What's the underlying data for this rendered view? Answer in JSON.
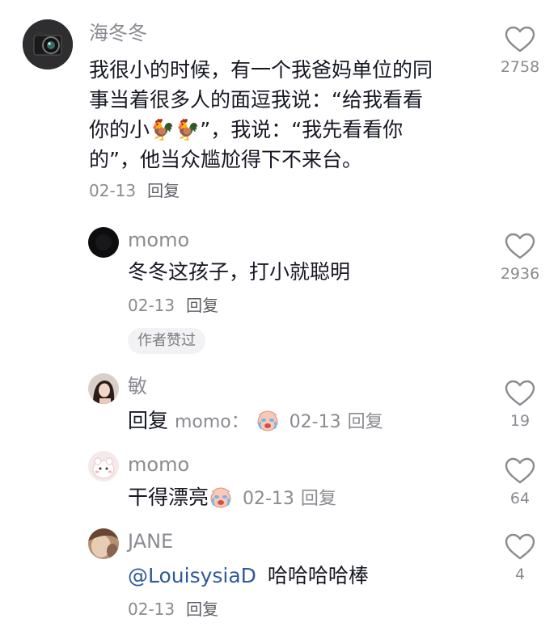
{
  "comments": [
    {
      "user": "海冬冬",
      "text_lines": [
        "我很小的时候，有一个我爸妈单位的同",
        "事当着很多人的面逗我说：“给我看看",
        "你的小🐓🐓”，我说：“我先看看你",
        "的”，他当众尴尬得下不来台。"
      ],
      "date": "02-13",
      "reply": "回复",
      "likes": "2758",
      "avatar_icon": "camera-avatar"
    },
    {
      "user": "momo",
      "text": "冬冬这孩子，打小就聪明",
      "date": "02-13",
      "reply": "回复",
      "likes": "2936",
      "badge": "作者赞过",
      "avatar_icon": "dark-avatar"
    },
    {
      "user": "敏",
      "reply_prefix": "回复",
      "reply_target": "momo：",
      "emoji": "crying-face-emoji",
      "date": "02-13",
      "reply": "回复",
      "likes": "19",
      "avatar_icon": "girl-photo-avatar"
    },
    {
      "user": "momo",
      "text": "干得漂亮",
      "emoji": "crying-face-emoji",
      "date": "02-13",
      "reply": "回复",
      "likes": "64",
      "avatar_icon": "cartoon-avatar"
    },
    {
      "user": "JANE",
      "mention": "@LouisysiaD",
      "text": "哈哈哈哈棒",
      "date": "02-13",
      "reply": "回复",
      "likes": "4",
      "avatar_icon": "brown-photo-avatar"
    }
  ],
  "colors": {
    "text": "#161823",
    "secondary": "#8a8b91",
    "mention": "#2f5a9b",
    "badge_bg": "#f2f2f4"
  }
}
